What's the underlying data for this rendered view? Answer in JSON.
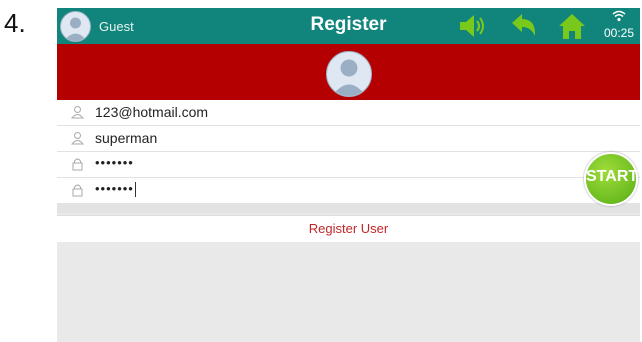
{
  "step_number": "4.",
  "topbar": {
    "user_name": "Guest",
    "title": "Register",
    "time": "00:25",
    "icons": [
      "avatar-icon",
      "speaker-icon",
      "back-icon",
      "home-icon",
      "wifi-icon"
    ]
  },
  "form": {
    "email": "123@hotmail.com",
    "username": "superman",
    "password": "•••••••",
    "confirm_password": "•••••••"
  },
  "register_label": "Register User",
  "start_label": "START",
  "colors": {
    "topbar": "#11857b",
    "banner": "#b40000",
    "accent_green": "#78c81e",
    "link_red": "#c2262a"
  }
}
